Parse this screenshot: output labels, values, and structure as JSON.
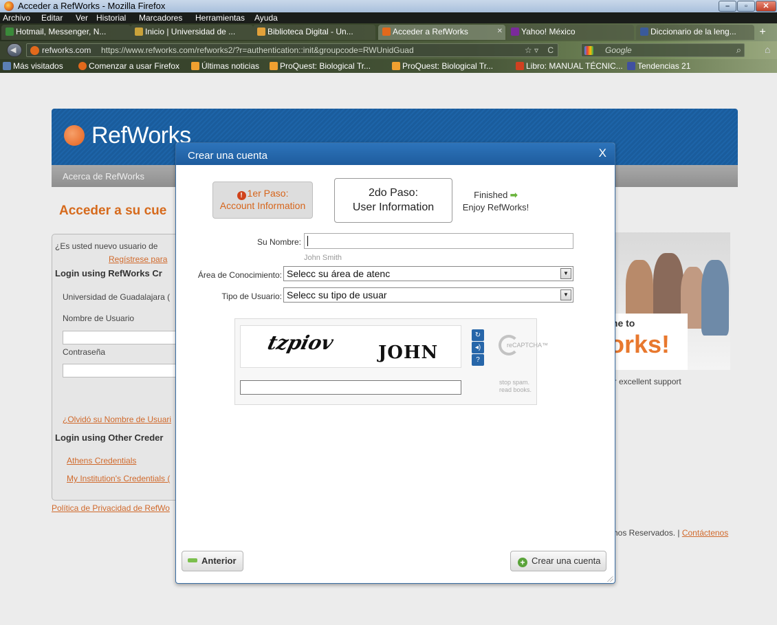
{
  "window": {
    "title": "Acceder a RefWorks - Mozilla Firefox"
  },
  "menu": [
    "Archivo",
    "Editar",
    "Ver",
    "Historial",
    "Marcadores",
    "Herramientas",
    "Ayuda"
  ],
  "tabs": [
    {
      "label": "Hotmail, Messenger, N...",
      "icon_color": "#3a8a3a"
    },
    {
      "label": "Inicio | Universidad de ...",
      "icon_color": "#c9a23a"
    },
    {
      "label": "Biblioteca Digital - Un...",
      "icon_color": "#e2a13a"
    },
    {
      "label": "Acceder a RefWorks",
      "icon_color": "#e2691c"
    },
    {
      "label": "Yahoo! México",
      "icon_color": "#7a2a9a"
    },
    {
      "label": "Diccionario de la leng...",
      "icon_color": "#3a5a9a"
    }
  ],
  "address": {
    "domain": "refworks.com",
    "url": "https://www.refworks.com/refworks2/?r=authentication::init&groupcode=RWUnidGuad",
    "search_placeholder": "Google"
  },
  "bookmarks": [
    {
      "label": "Más visitados",
      "icon_color": "#5b7fb5"
    },
    {
      "label": "Comenzar a usar Firefox",
      "icon_color": "#e2691c"
    },
    {
      "label": "Últimas noticias",
      "icon_color": "#f0a030"
    },
    {
      "label": "ProQuest: Biological Tr...",
      "icon_color": "#f0a030"
    },
    {
      "label": "ProQuest: Biological Tr...",
      "icon_color": "#f0a030"
    },
    {
      "label": "Libro: MANUAL TÉCNIC...",
      "icon_color": "#d04020"
    },
    {
      "label": "Tendencias 21",
      "icon_color": "#4050a0"
    }
  ],
  "page": {
    "brand": "RefWorks",
    "nav_item": "Acerca de RefWorks",
    "heading": "Acceder a su cue",
    "login": {
      "new_user": "¿Es usted nuevo usuario de",
      "register": "Regístrese para",
      "login_rw": "Login using RefWorks Cr",
      "institution": "Universidad de Guadalajara (",
      "username_label": "Nombre de Usuario",
      "password_label": "Contraseña",
      "forgot": "¿Olvidó su Nombre de Usuari",
      "login_other": "Login using Other Creder",
      "athens": "Athens Credentials",
      "institution_cred": "My Institution's Credentials ("
    },
    "privacy": "Política de Privacidad de RefWo",
    "welcome_to": "me to",
    "welcome_big": "orks!",
    "support": "ur excellent support",
    "footer": "chos Reservados. |",
    "contact": "Contáctenos"
  },
  "modal": {
    "title": "Crear una cuenta",
    "close": "X",
    "step1": {
      "line1": "1er Paso:",
      "line2": "Account Information"
    },
    "step2": {
      "line1": "2do Paso:",
      "line2": "User Information"
    },
    "step3": {
      "line1": "Finished",
      "line2": "Enjoy RefWorks!"
    },
    "name_label": "Su Nombre:",
    "name_value": "",
    "name_hint": "John Smith",
    "area_label": "Área de Conocimiento:",
    "area_value": "Selecc su área de atenc",
    "type_label": "Tipo de Usuario:",
    "type_value": "Selecc su tipo de usuar",
    "captcha": {
      "word1": "tzpiov",
      "word2": "JOHN",
      "brand": "reCAPTCHA™",
      "tagline1": "stop spam.",
      "tagline2": "read books."
    },
    "back_button": "Anterior",
    "create_button": "Crear una cuenta"
  }
}
